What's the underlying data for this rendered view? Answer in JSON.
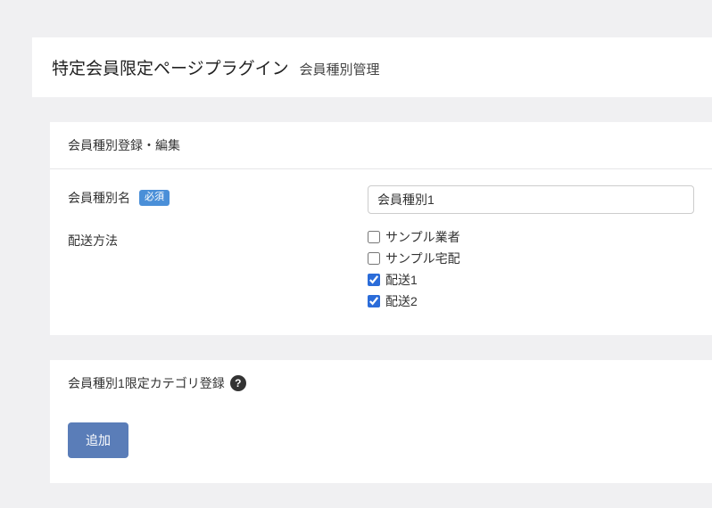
{
  "header": {
    "title": "特定会員限定ページプラグイン",
    "subtitle": "会員種別管理"
  },
  "editSection": {
    "heading": "会員種別登録・編集",
    "nameField": {
      "label": "会員種別名",
      "requiredBadge": "必須",
      "value": "会員種別1"
    },
    "deliveryField": {
      "label": "配送方法",
      "options": [
        {
          "label": "サンプル業者",
          "checked": false
        },
        {
          "label": "サンプル宅配",
          "checked": false
        },
        {
          "label": "配送1",
          "checked": true
        },
        {
          "label": "配送2",
          "checked": true
        }
      ]
    }
  },
  "categorySection": {
    "heading": "会員種別1限定カテゴリ登録",
    "helpIcon": "?",
    "addButton": "追加"
  }
}
